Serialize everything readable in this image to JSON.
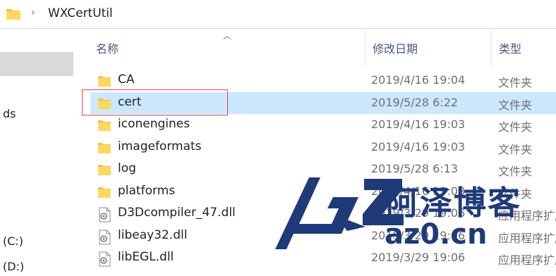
{
  "address_bar": {
    "path": "WXCertUtil"
  },
  "nav_pane": {
    "items": [
      {
        "label": "ds"
      },
      {
        "label": "(C:)"
      },
      {
        "label": "(D:)"
      }
    ]
  },
  "columns": {
    "name": "名称",
    "date": "修改日期",
    "type": "类型"
  },
  "files": [
    {
      "name": "CA",
      "date": "2019/4/16 19:04",
      "type": "文件夹",
      "icon": "folder-icon"
    },
    {
      "name": "cert",
      "date": "2019/5/28 6:22",
      "type": "文件夹",
      "icon": "folder-icon"
    },
    {
      "name": "iconengines",
      "date": "2019/4/16 19:03",
      "type": "文件夹",
      "icon": "folder-icon"
    },
    {
      "name": "imageformats",
      "date": "2019/4/16 19:03",
      "type": "文件夹",
      "icon": "folder-icon"
    },
    {
      "name": "log",
      "date": "2019/5/28 6:13",
      "type": "文件夹",
      "icon": "folder-icon"
    },
    {
      "name": "platforms",
      "date": "2019/4/16 19:03",
      "type": "文件夹",
      "icon": "folder-icon"
    },
    {
      "name": "D3Dcompiler_47.dll",
      "date": "2019/3/29 19:06",
      "type": "应用程序扩展",
      "icon": "dll-file-icon"
    },
    {
      "name": "libeay32.dll",
      "date": "2019/3/29 19:06",
      "type": "应用程序扩展",
      "icon": "dll-file-icon"
    },
    {
      "name": "libEGL.dll",
      "date": "2019/3/29 19:06",
      "type": "应用程序扩展",
      "icon": "dll-file-icon"
    }
  ],
  "watermark": {
    "logo": "AZ",
    "text": "阿泽博客",
    "url": "az0.cn"
  },
  "colors": {
    "folder": "#f2c143",
    "selection": "#cce8ff",
    "highlight_box": "#e0474c",
    "watermark": "#1f3a78"
  }
}
